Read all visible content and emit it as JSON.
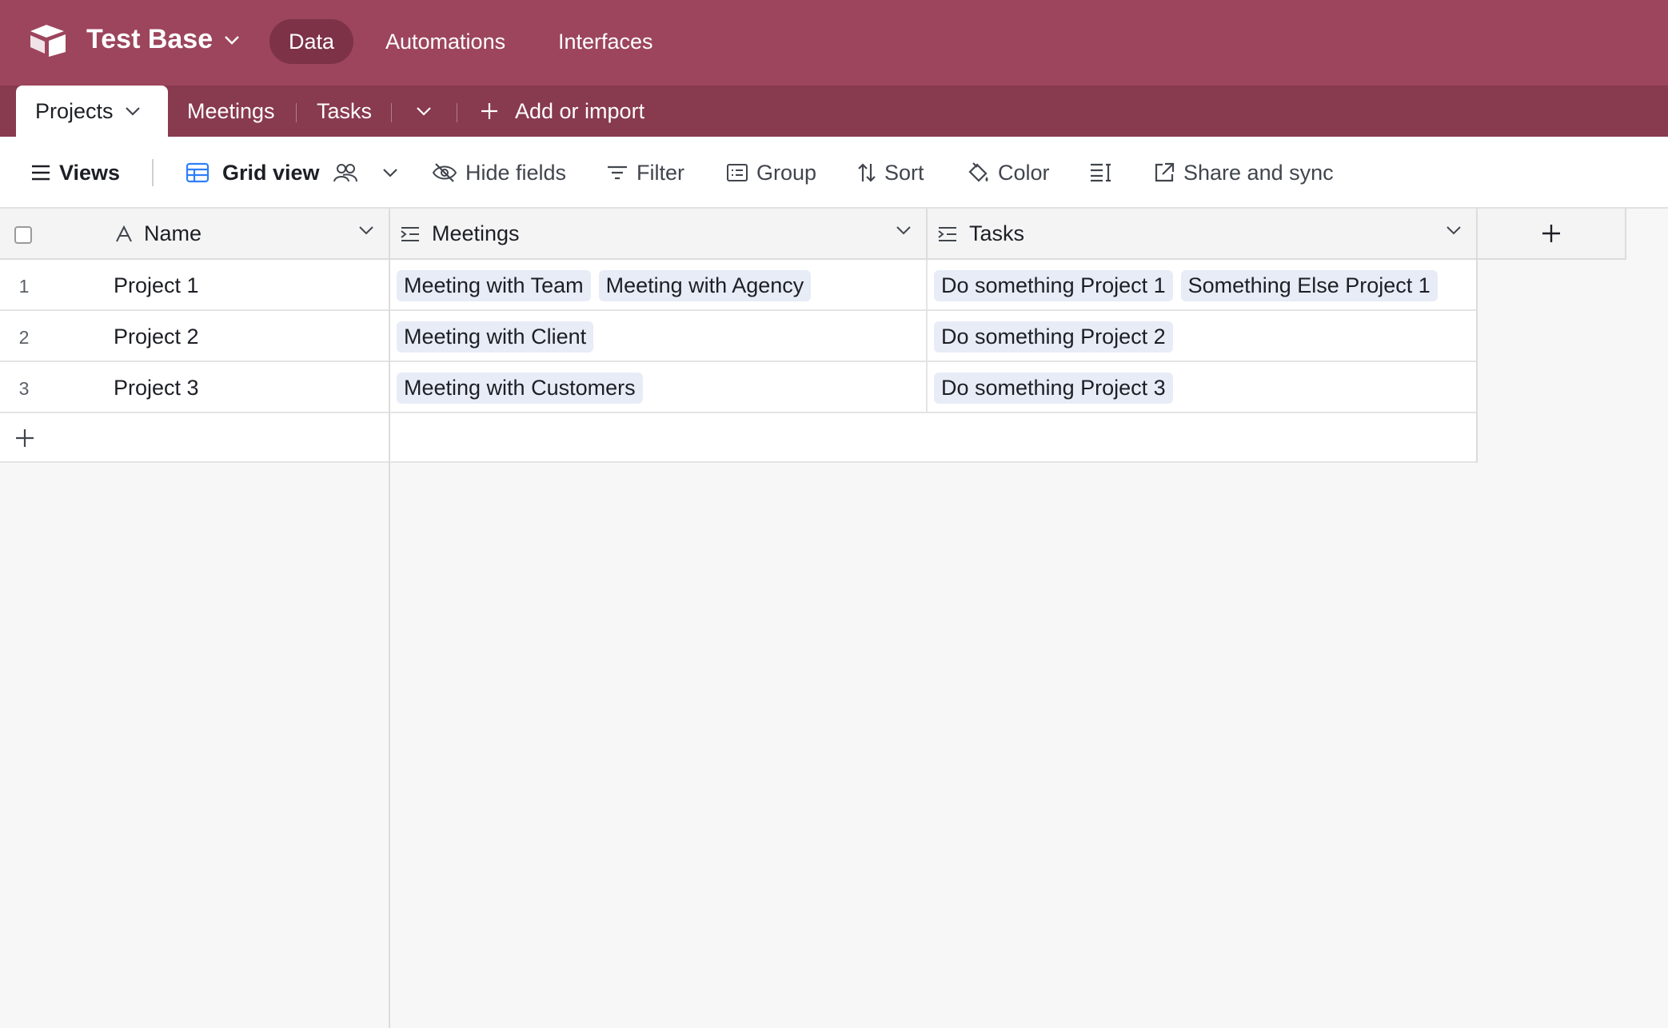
{
  "header": {
    "base_name": "Test Base",
    "nav": [
      "Data",
      "Automations",
      "Interfaces"
    ],
    "active_nav": "Data"
  },
  "tabs": {
    "active": "Projects",
    "items": [
      "Meetings",
      "Tasks"
    ],
    "add_label": "Add or import"
  },
  "toolbar": {
    "views_label": "Views",
    "view_name": "Grid view",
    "hide_fields": "Hide fields",
    "filter": "Filter",
    "group": "Group",
    "sort": "Sort",
    "color": "Color",
    "share": "Share and sync"
  },
  "table": {
    "columns": [
      "Name",
      "Meetings",
      "Tasks"
    ],
    "rows": [
      {
        "num": "1",
        "name": "Project 1",
        "meetings": [
          "Meeting with Team",
          "Meeting with Agency"
        ],
        "tasks": [
          "Do something Project 1",
          "Something Else Project 1"
        ]
      },
      {
        "num": "2",
        "name": "Project 2",
        "meetings": [
          "Meeting with Client"
        ],
        "tasks": [
          "Do something Project 2"
        ]
      },
      {
        "num": "3",
        "name": "Project 3",
        "meetings": [
          "Meeting with Customers"
        ],
        "tasks": [
          "Do something Project 3"
        ]
      }
    ]
  },
  "colors": {
    "header_bg": "#9c455c",
    "tabbar_bg": "#883a4f",
    "chip_bg": "#e7ecf7"
  }
}
